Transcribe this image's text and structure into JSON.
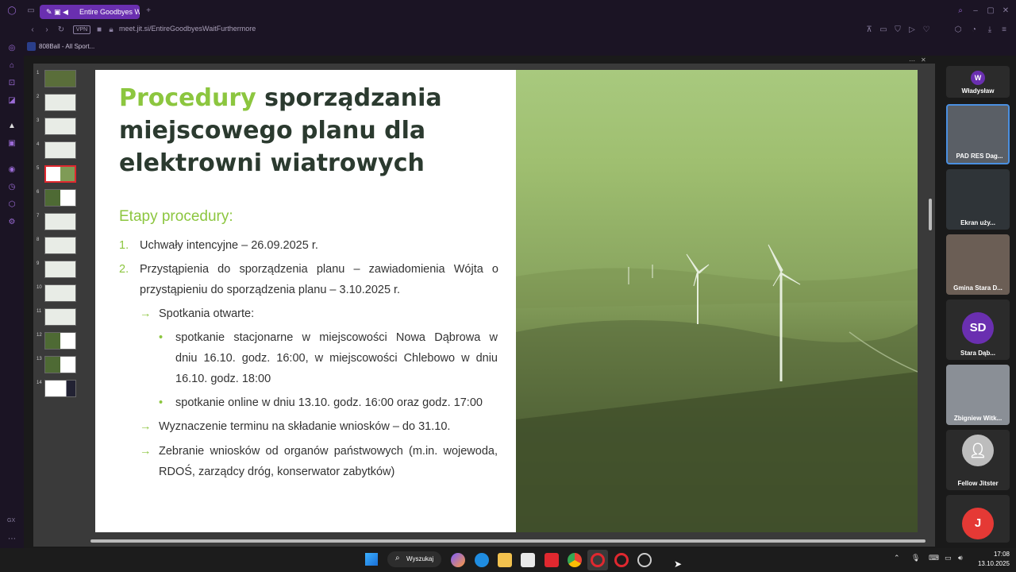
{
  "browser": {
    "tab_title": "Entire Goodbyes W",
    "url": "meet.jit.si/EntireGoodbyesWaitFurthermore",
    "vpn": "VPN",
    "bookmark": "808Ball - All Sport...",
    "gx": "GX"
  },
  "thumbnails": [
    "1",
    "2",
    "3",
    "4",
    "5",
    "6",
    "7",
    "8",
    "9",
    "10",
    "11",
    "12",
    "13",
    "14"
  ],
  "slide": {
    "title_accent": "Procedury",
    "title_rest_1": "sporządzania",
    "title_line_2": "miejscowego planu dla",
    "title_line_3": "elektrowni wiatrowych",
    "subtitle": "Etapy procedury:",
    "item1_num": "1.",
    "item1": "Uchwały intencyjne – 26.09.2025 r.",
    "item2_num": "2.",
    "item2_l1": "Przystąpienia do sporządzenia planu – zawiadomienia Wójta o",
    "item2_l2": "przystąpieniu do sporządzenia planu – 3.10.2025 r.",
    "sub1": "Spotkania otwarte:",
    "bullet1_l1": "spotkanie stacjonarne w miejscowości Nowa Dąbrowa w",
    "bullet1_l2": "dniu 16.10. godz. 16:00, w miejscowości Chlebowo w dniu",
    "bullet1_l3": "16.10. godz. 18:00",
    "bullet2": "spotkanie online w dniu 13.10. godz. 16:00 oraz godz. 17:00",
    "sub2": "Wyznaczenie terminu na składanie wniosków – do 31.10.",
    "sub3_l1": "Zebranie wniosków od organów państwowych (m.in. wojewoda,",
    "sub3_l2": "RDOŚ, zarządcy dróg, konserwator zabytków)"
  },
  "participants": [
    {
      "initial": "W",
      "name": "Władysław"
    },
    {
      "name": "PAD RES Dag..."
    },
    {
      "name": "Ekran uży..."
    },
    {
      "name": "Gmina Stara D..."
    },
    {
      "initial": "SD",
      "name": "Stara Dąb..."
    },
    {
      "name": "Zbigniew Witk..."
    },
    {
      "name": "Fellow Jitster"
    },
    {
      "initial": "J"
    }
  ],
  "taskbar": {
    "search": "Wyszukaj",
    "time": "17:08",
    "date": "13.10.2025"
  },
  "colors": {
    "accent_green": "#8cc63f",
    "title_dark": "#2b3a2f",
    "browser_purple": "#6a2fb0"
  }
}
